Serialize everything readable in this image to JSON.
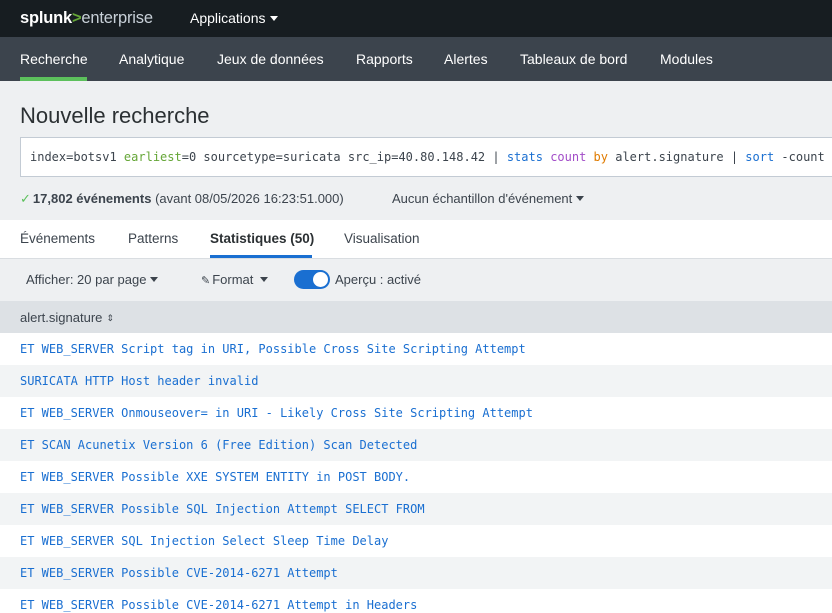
{
  "topbar": {
    "logo_brand": "splunk",
    "logo_gt": ">",
    "logo_product": "enterprise",
    "apps_label": "Applications"
  },
  "nav": {
    "items": [
      "Recherche",
      "Analytique",
      "Jeux de données",
      "Rapports",
      "Alertes",
      "Tableaux de bord",
      "Modules"
    ],
    "active": "Recherche"
  },
  "page_title": "Nouvelle recherche",
  "search": {
    "query_parts": [
      {
        "text": "index=botsv1 ",
        "style": "plain"
      },
      {
        "text": "earliest",
        "style": "green"
      },
      {
        "text": "=0 sourcetype=suricata src_ip=40.80.148.42 | ",
        "style": "plain"
      },
      {
        "text": "stats",
        "style": "blue"
      },
      {
        "text": " ",
        "style": "plain"
      },
      {
        "text": "count",
        "style": "purple"
      },
      {
        "text": " ",
        "style": "plain"
      },
      {
        "text": "by",
        "style": "orange"
      },
      {
        "text": " alert.signature | ",
        "style": "plain"
      },
      {
        "text": "sort",
        "style": "blue"
      },
      {
        "text": " -count",
        "style": "plain"
      }
    ]
  },
  "status": {
    "count": "17,802 événements",
    "detail": "(avant 08/05/2026 16:23:51.000)",
    "sample_label": "Aucun échantillon d'événement"
  },
  "tabs": {
    "events": "Événements",
    "patterns": "Patterns",
    "statistics": "Statistiques (50)",
    "visualization": "Visualisation"
  },
  "controls": {
    "show_label": "Afficher: 20 par page",
    "format_label": "Format",
    "preview_label": "Aperçu : activé"
  },
  "table": {
    "column": "alert.signature",
    "rows": [
      "ET WEB_SERVER Script tag in URI, Possible Cross Site Scripting Attempt",
      "SURICATA HTTP Host header invalid",
      "ET WEB_SERVER Onmouseover= in URI - Likely Cross Site Scripting Attempt",
      "ET SCAN Acunetix Version 6 (Free Edition) Scan Detected",
      "ET WEB_SERVER Possible XXE SYSTEM ENTITY in POST BODY.",
      "ET WEB_SERVER Possible SQL Injection Attempt SELECT FROM",
      "ET WEB_SERVER SQL Injection Select Sleep Time Delay",
      "ET WEB_SERVER Possible CVE-2014-6271 Attempt",
      "ET WEB_SERVER Possible CVE-2014-6271 Attempt in Headers"
    ]
  },
  "colors": {
    "accent_green": "#5cc05c",
    "accent_blue": "#1a6fd1",
    "topbar_bg": "#171d21",
    "navbar_bg": "#3c444d"
  }
}
